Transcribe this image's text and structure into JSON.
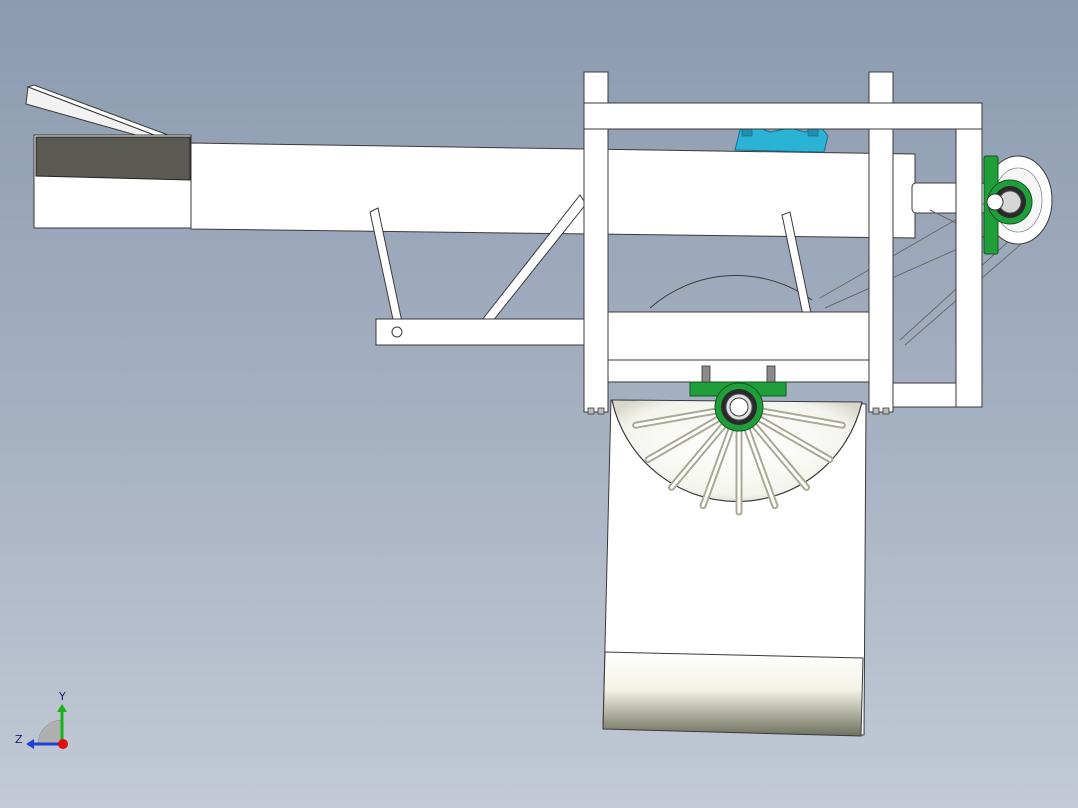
{
  "viewport": {
    "background_top": "#8c9bb0",
    "background_bottom": "#c3cad6"
  },
  "model": {
    "part_fill": "#ffffff",
    "edge_color": "#3a3a3a",
    "bearing_color": "#1f9e3a",
    "motor_color": "#2bb3d6",
    "hopper_dark": "#5a5a52",
    "spokes": 9
  },
  "triad": {
    "x_color": "#e01010",
    "y_color": "#17b317",
    "z_color": "#1f3fd6",
    "labels": {
      "y": "Y",
      "z": "Z"
    }
  }
}
